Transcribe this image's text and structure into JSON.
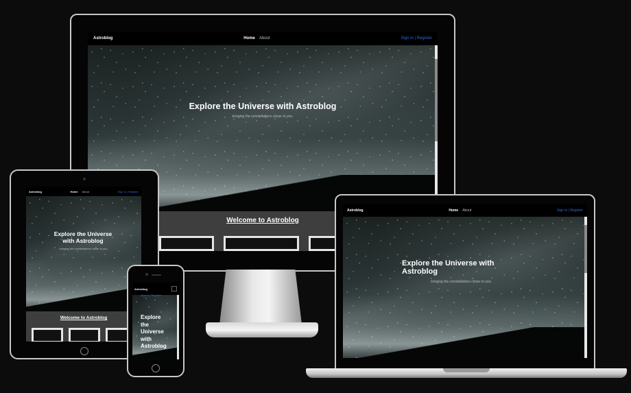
{
  "site": {
    "brand": "Astroblog",
    "nav_home": "Home",
    "nav_about": "About",
    "auth": "Sign in | Register",
    "hero_title": "Explore the Universe with Astroblog",
    "hero_subtitle": "bringing the constellations closer to you.",
    "welcome": "Welcome to Astroblog"
  },
  "phone": {
    "hero_lines": [
      "Explore",
      "the",
      "Universe",
      "with",
      "Astroblog"
    ],
    "menu_icon": "hamburger-menu-icon"
  },
  "colors": {
    "background": "#0d0c0d",
    "link_blue": "#2c6dd6",
    "band_gray": "#3e3e3e"
  }
}
